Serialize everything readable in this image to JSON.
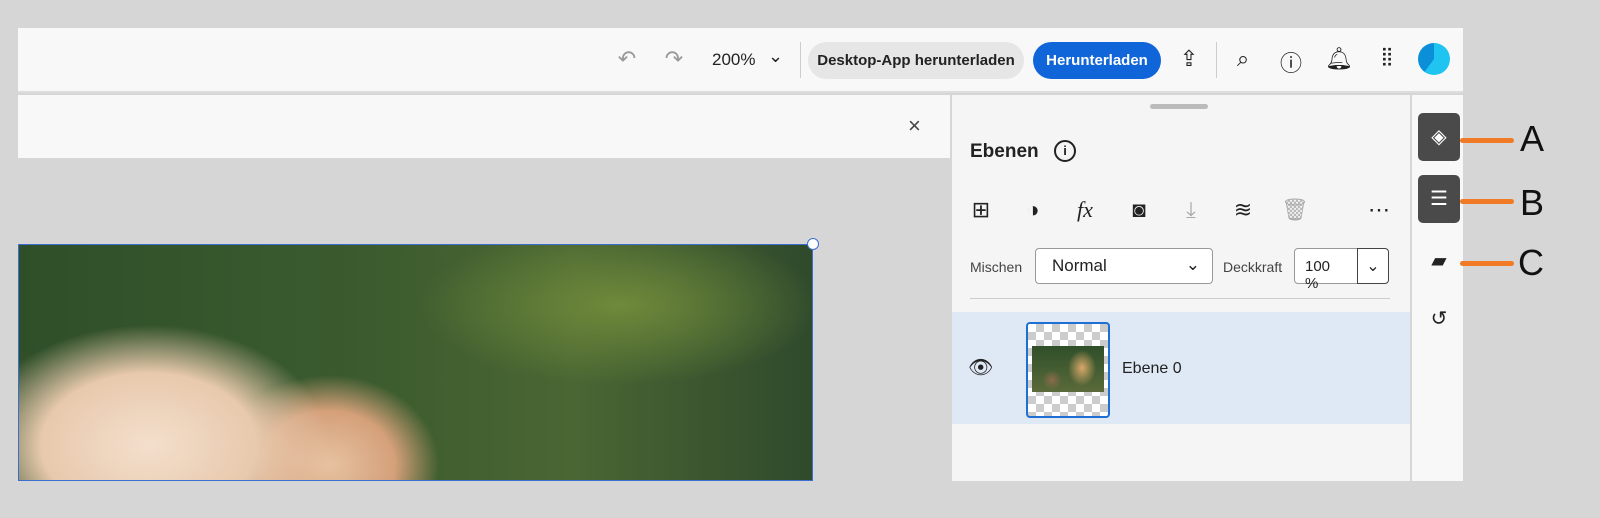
{
  "toolbar": {
    "zoom": "200%",
    "desktop_app": "Desktop-App herunterladen",
    "download": "Herunterladen"
  },
  "panel": {
    "title": "Ebenen",
    "blend_label": "Mischen",
    "blend_value": "Normal",
    "opacity_label": "Deckkraft",
    "opacity_value": "100 %"
  },
  "layers": [
    {
      "name": "Ebene 0"
    }
  ],
  "annotations": [
    "A",
    "B",
    "C"
  ],
  "colors": {
    "accent": "#1066d8",
    "annotation": "#f07a25"
  }
}
